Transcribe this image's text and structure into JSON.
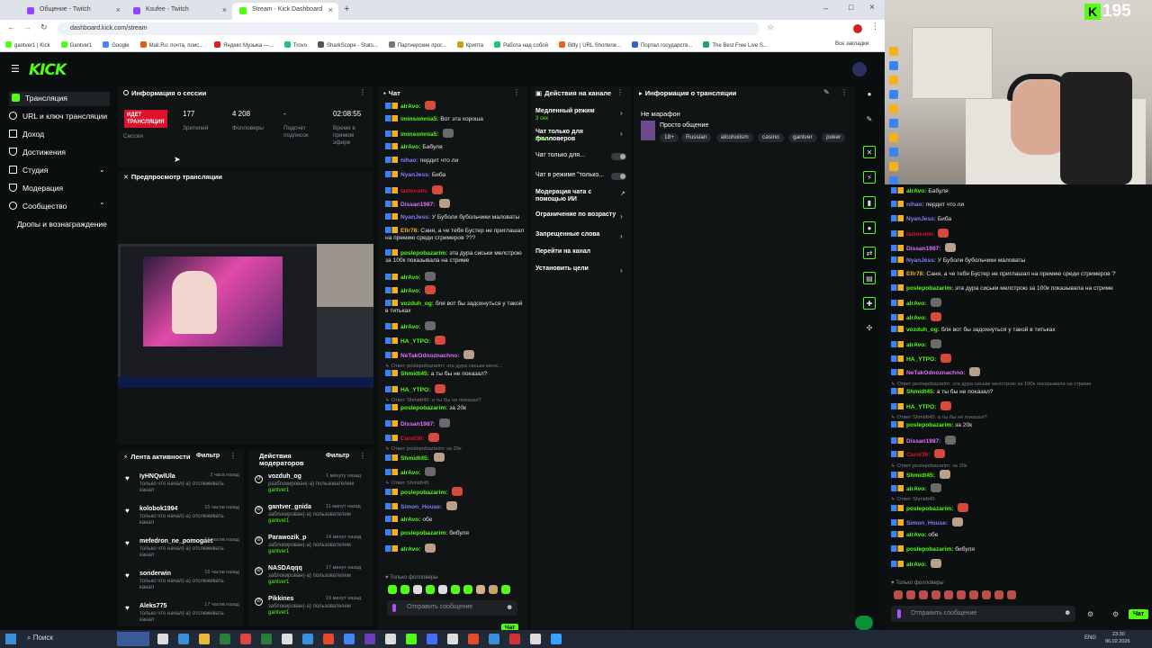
{
  "browser": {
    "tabs": [
      "Общение - Twitch",
      "Ksufee - Twitch",
      "Stream - Kick Dashboard"
    ],
    "url": "dashboard.kick.com/stream",
    "bookmarks": [
      "gantver1 | Kick",
      "Gantver1",
      "Google",
      "Mail.Ru: почта, поис...",
      "Яндекс Музыка —...",
      "Trovo",
      "SharkScope - Stats...",
      "Партнерские прог...",
      "Крипта",
      "Работа над собой",
      "Bitly | URL Shortene...",
      "Портал государств...",
      "The Best Free Live S..."
    ],
    "all_bookmarks": "Все закладки"
  },
  "logo": "KICK",
  "sidebar": {
    "items": [
      "Трансляция",
      "URL и ключ трансляции",
      "Доход",
      "Достижения",
      "Студия",
      "Модерация",
      "Сообщество",
      "Дропы и вознаграждение"
    ]
  },
  "session": {
    "title": "Информация о сессии",
    "live_badge": "ИДЕТ ТРАНСЛЯЦИЯ",
    "session_label": "Сессия",
    "viewers": "177",
    "viewers_label": "Зрителей",
    "followers": "4 208",
    "followers_label": "Фолловеры",
    "subs": "-",
    "subs_label": "Подсчет подписок",
    "time": "02:08:55",
    "time_label": "Время в прямом эфире"
  },
  "preview": {
    "title": "Предпросмотр трансляции"
  },
  "activity": {
    "title": "Лента активности",
    "filter": "Фильтр",
    "items": [
      {
        "name": "IyHNQwlUla",
        "time": "2 часа назад",
        "sub": "только что начал(-а) отслеживать канал"
      },
      {
        "name": "kolobok1994",
        "time": "15 часов назад",
        "sub": "только что начал(-а) отслеживать канал"
      },
      {
        "name": "mefedron_ne_pomogaet",
        "time": "16 часов назад",
        "sub": "только что начал(-а) отслеживать канал"
      },
      {
        "name": "sonderwin",
        "time": "16 часов назад",
        "sub": "только что начал(-а) отслеживать канал"
      },
      {
        "name": "Aleks775",
        "time": "17 часов назад",
        "sub": "только что начал(-а) отслеживать канал"
      }
    ]
  },
  "modactions": {
    "title": "Действия модераторов",
    "filter": "Фильтр",
    "items": [
      {
        "name": "vozduh_og",
        "time": "1 минуту назад",
        "sub": "разблокирован(-а) пользователем",
        "by": "gantver1"
      },
      {
        "name": "gantver_gnida",
        "time": "11 минут назад",
        "sub": "заблокирован(-а) пользователем",
        "by": "gantver1"
      },
      {
        "name": "Parawozik_p",
        "time": "14 минут назад",
        "sub": "заблокирован(-а) пользователем",
        "by": "gantver1"
      },
      {
        "name": "NASDAqqq",
        "time": "17 минут назад",
        "sub": "заблокирован(-а) пользователем",
        "by": "gantver1"
      },
      {
        "name": "Pikkines",
        "time": "19 минут назад",
        "sub": "заблокирован(-а) пользователем",
        "by": "gantver1"
      }
    ]
  },
  "chat": {
    "title": "Чат",
    "lines": [
      {
        "user": "alrAvo:",
        "text": "",
        "color": "#53fc18"
      },
      {
        "user": "iminsomnia5:",
        "text": "Вот эта хороша",
        "color": "#53fc18"
      },
      {
        "user": "iminsomnia5:",
        "text": "",
        "color": "#53fc18"
      },
      {
        "user": "alrAvo:",
        "text": "Бабуля",
        "color": "#53fc18"
      },
      {
        "user": "nihao:",
        "text": "пердит что ли",
        "color": "#7f7fff"
      },
      {
        "user": "NyanJess:",
        "text": "Биба",
        "color": "#7f7fff"
      },
      {
        "user": "laziocom:",
        "text": "",
        "color": "#e0112b"
      },
      {
        "user": "Dissan1987:",
        "text": "",
        "color": "#e070ff"
      },
      {
        "user": "NyanJess:",
        "text": "У Буболи бубольчики маловаты",
        "color": "#7f7fff"
      },
      {
        "user": "Efir78:",
        "text": "Саня, а че тебя Бустер не приглашал на премию среди стримеров ???",
        "color": "#f5b021"
      },
      {
        "user": "poslepobazarim:",
        "text": "эта дура сиськи мелстрою за 100к показывала на стриме",
        "color": "#53fc18"
      },
      {
        "user": "alrAvo:",
        "text": "",
        "color": "#53fc18"
      },
      {
        "user": "alrAvo:",
        "text": "",
        "color": "#53fc18"
      },
      {
        "user": "vozduh_og:",
        "text": "бля вот бы задохнуться у такой в титьках",
        "color": "#53fc18"
      },
      {
        "user": "alrAvo:",
        "text": "",
        "color": "#53fc18"
      },
      {
        "user": "HA_YTPO:",
        "text": "",
        "color": "#53fc18"
      },
      {
        "user": "NeTakOdnoznachno:",
        "text": "",
        "color": "#e070ff"
      },
      {
        "reply": "Ответ poslepobazarim: эта дура сиськи мелс...",
        "user": "Shmidt45:",
        "text": "а ты бы не показал?",
        "color": "#53fc18"
      },
      {
        "user": "HA_YTPO:",
        "text": "",
        "color": "#53fc18"
      },
      {
        "reply": "Ответ Shmidt45: а ты бы не показал?",
        "user": "poslepobazarim:",
        "text": "за 20к",
        "color": "#53fc18"
      },
      {
        "user": "Dissan1987:",
        "text": "",
        "color": "#e070ff"
      },
      {
        "user": "Carol36:",
        "text": "",
        "color": "#e0112b"
      },
      {
        "reply": "Ответ poslepobazarim: за 20к",
        "user": "Shmidt45:",
        "text": "",
        "color": "#53fc18"
      },
      {
        "user": "alrAvo:",
        "text": "",
        "color": "#53fc18"
      },
      {
        "reply": "Ответ Shmidt45:",
        "user": "poslepobazarim:",
        "text": "",
        "color": "#53fc18"
      },
      {
        "user": "Simon_House:",
        "text": "",
        "color": "#7f7fff"
      },
      {
        "user": "alrAvo:",
        "text": "обе",
        "color": "#53fc18"
      },
      {
        "user": "poslepobazarim:",
        "text": "бибуля",
        "color": "#53fc18"
      },
      {
        "user": "alrAvo:",
        "text": "",
        "color": "#53fc18"
      }
    ],
    "followers_only": "Только фолловеры",
    "placeholder": "Отправить сообщение",
    "send_label": "Чат"
  },
  "channel_actions": {
    "title": "Действия на канале",
    "items": [
      {
        "label": "Медленный режим",
        "sub": "3 сек",
        "kind": "chevron"
      },
      {
        "label": "Чат только для фолловеров",
        "sub": "5 мин",
        "kind": "chevron"
      },
      {
        "label": "Чат только для...",
        "sub": "",
        "kind": "toggle"
      },
      {
        "label": "Чат в режиме \"только...",
        "sub": "",
        "kind": "toggle"
      },
      {
        "label": "Модерация чата с помощью ИИ",
        "sub": "",
        "kind": "external"
      },
      {
        "label": "Ограничение по возрасту",
        "sub": "",
        "kind": "chevron"
      },
      {
        "label": "Запрещенные слова",
        "sub": "",
        "kind": "chevron"
      },
      {
        "label": "Перейти на канал",
        "sub": "",
        "kind": "none"
      },
      {
        "label": "Установить цели",
        "sub": "",
        "kind": "chevron"
      }
    ]
  },
  "stream_info": {
    "title": "Информация о трансляции",
    "stream_title": "Не марафон",
    "category": "Просто общение",
    "tags": [
      "18+",
      "Russian",
      "alcoholism",
      "casino",
      "gantver",
      "poker"
    ]
  },
  "overlay": {
    "viewer_count": "195"
  },
  "right_chat": {
    "lines": [
      {
        "user": "alrAvo:",
        "text": "Бабуля",
        "color": "#53fc18"
      },
      {
        "user": "nihao:",
        "text": "пердит что ли",
        "color": "#7f7fff"
      },
      {
        "user": "NyanJess:",
        "text": "Биба",
        "color": "#7f7fff"
      },
      {
        "user": "laziocom:",
        "text": "",
        "color": "#e0112b"
      },
      {
        "user": "Dissan1987:",
        "text": "",
        "color": "#e070ff"
      },
      {
        "user": "NyanJess:",
        "text": "У Буболи бубольчики маловаты",
        "color": "#7f7fff"
      },
      {
        "user": "Efir78:",
        "text": "Саня, а че тебя Бустер не приглашал на премию среди стримеров ???",
        "color": "#f5b021"
      },
      {
        "user": "poslepobazarim:",
        "text": "эта дура сиськи мелстрою за 100к показывала на стриме",
        "color": "#53fc18"
      },
      {
        "user": "alrAvo:",
        "text": "",
        "color": "#53fc18"
      },
      {
        "user": "alrAvo:",
        "text": "",
        "color": "#53fc18"
      },
      {
        "user": "vozduh_og:",
        "text": "бля вот бы задохнуться у такой в титьках",
        "color": "#53fc18"
      },
      {
        "user": "alrAvo:",
        "text": "",
        "color": "#53fc18"
      },
      {
        "user": "HA_YTPO:",
        "text": "",
        "color": "#53fc18"
      },
      {
        "user": "NeTakOdnoznachno:",
        "text": "",
        "color": "#e070ff"
      },
      {
        "reply": "Ответ poslepobazarim: эта дура сиськи мелстрою за 100к показывала на стриме",
        "user": "Shmidt45:",
        "text": "а ты бы не показал?",
        "color": "#53fc18"
      },
      {
        "user": "HA_YTPO:",
        "text": "",
        "color": "#53fc18"
      },
      {
        "reply": "Ответ Shmidt45: а ты бы не показал?",
        "user": "poslepobazarim:",
        "text": "за 20к",
        "color": "#53fc18"
      },
      {
        "user": "Dissan1987:",
        "text": "",
        "color": "#e070ff"
      },
      {
        "user": "Carol36:",
        "text": "",
        "color": "#e0112b"
      },
      {
        "reply": "Ответ poslepobazarim: за 20к",
        "user": "Shmidt45:",
        "text": "",
        "color": "#53fc18"
      },
      {
        "user": "alrAvo:",
        "text": "",
        "color": "#53fc18"
      },
      {
        "reply": "Ответ Shmidt45:",
        "user": "poslepobazarim:",
        "text": "",
        "color": "#53fc18"
      },
      {
        "user": "Simon_House:",
        "text": "",
        "color": "#7f7fff"
      },
      {
        "user": "alrAvo:",
        "text": "обе",
        "color": "#53fc18"
      },
      {
        "user": "poslepobazarim:",
        "text": "бибуля",
        "color": "#53fc18"
      },
      {
        "user": "alrAvo:",
        "text": "",
        "color": "#53fc18"
      }
    ],
    "followers_only": "Только фолловеры",
    "placeholder": "Отправить сообщение",
    "send_label": "Чат"
  },
  "taskbar": {
    "search": "Поиск",
    "lang": "ENG",
    "time": "23:30",
    "date": "06.02.2026"
  }
}
